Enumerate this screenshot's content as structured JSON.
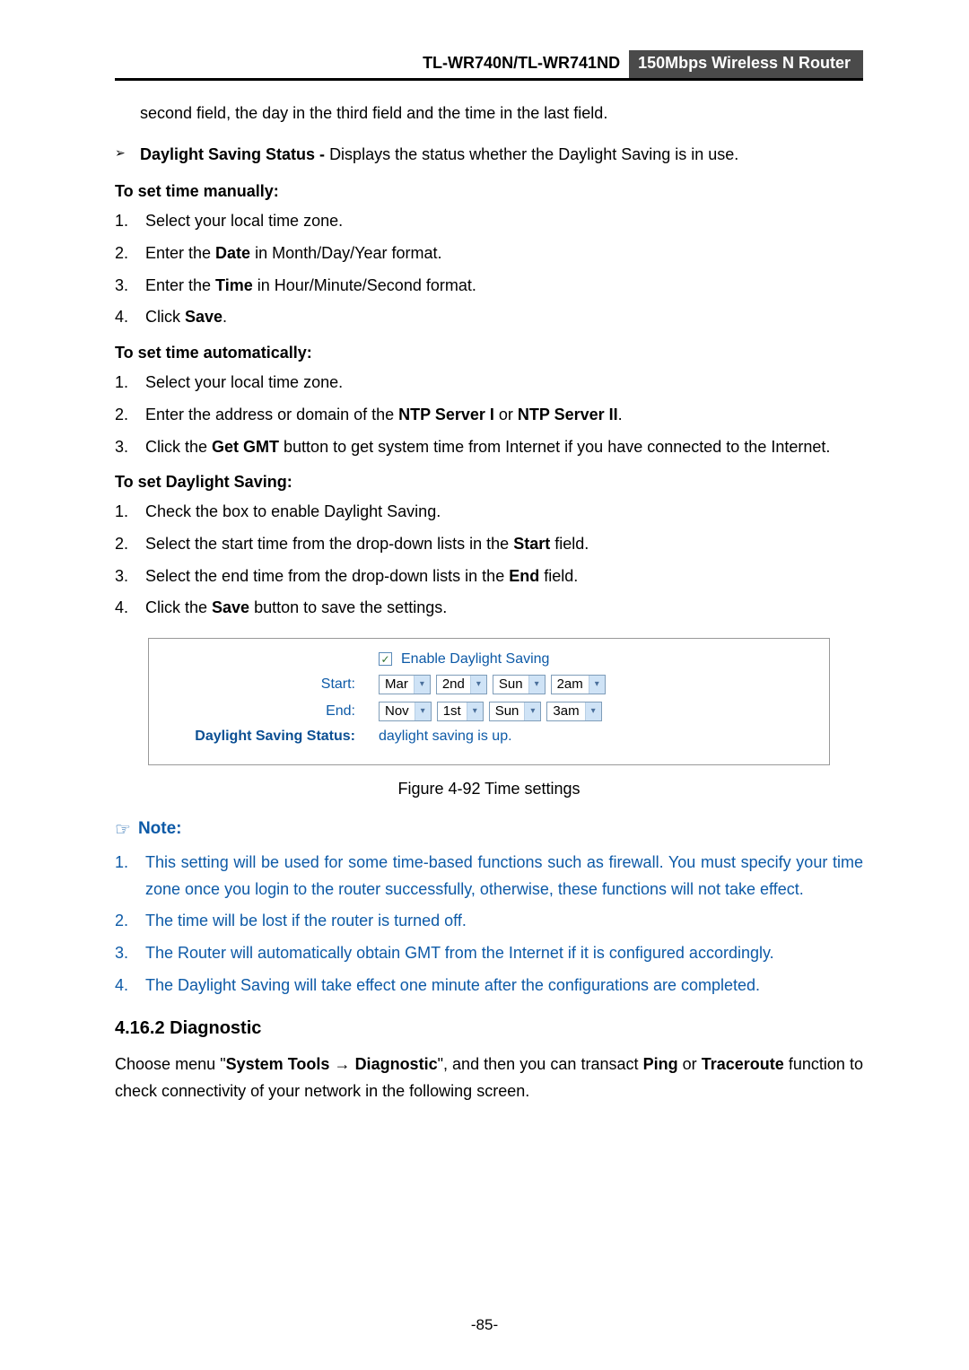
{
  "header": {
    "model": "TL-WR740N/TL-WR741ND",
    "product": "150Mbps Wireless N Router"
  },
  "intro_continuation": "second field, the day in the third field and the time in the last field.",
  "bullet": {
    "marker": "➢",
    "label": "Daylight Saving Status -",
    "desc": "Displays the status whether the Daylight Saving is in use."
  },
  "manual": {
    "heading": "To set time manually:",
    "steps": [
      {
        "n": "1.",
        "pre": "Select your local time zone."
      },
      {
        "n": "2.",
        "pre": "Enter the ",
        "b": "Date",
        "post": " in Month/Day/Year format."
      },
      {
        "n": "3.",
        "pre": "Enter the ",
        "b": "Time",
        "post": " in Hour/Minute/Second format."
      },
      {
        "n": "4.",
        "pre": "Click ",
        "b": "Save",
        "post": "."
      }
    ]
  },
  "auto": {
    "heading": "To set time automatically:",
    "steps": [
      {
        "n": "1.",
        "txt": "Select your local time zone."
      },
      {
        "n": "2.",
        "pre": "Enter the address or domain of the ",
        "b1": "NTP Server I",
        "mid": " or ",
        "b2": "NTP Server II",
        "post": "."
      },
      {
        "n": "3.",
        "pre": "Click the ",
        "b": "Get GMT",
        "post": " button to get system time from Internet if you have connected to the Internet."
      }
    ]
  },
  "dst": {
    "heading": "To set Daylight Saving:",
    "steps": [
      {
        "n": "1.",
        "txt": "Check the box to enable Daylight Saving."
      },
      {
        "n": "2.",
        "pre": "Select the start time from the drop-down lists in the ",
        "b": "Start",
        "post": " field."
      },
      {
        "n": "3.",
        "pre": "Select the end time from the drop-down lists in the ",
        "b": "End",
        "post": " field."
      },
      {
        "n": "4.",
        "pre": "Click the ",
        "b": "Save",
        "post": " button to save the settings."
      }
    ]
  },
  "panel": {
    "enable_label": "Enable Daylight Saving",
    "rows": [
      {
        "label": "Start:",
        "vals": [
          "Mar",
          "2nd",
          "Sun",
          "2am"
        ]
      },
      {
        "label": "End:",
        "vals": [
          "Nov",
          "1st",
          "Sun",
          "3am"
        ]
      }
    ],
    "status_label": "Daylight Saving Status:",
    "status_value": "daylight saving is up."
  },
  "figure_caption": "Figure 4-92   Time settings",
  "note": {
    "icon": "☞",
    "label": "Note:",
    "items": [
      {
        "n": "1.",
        "txt": "This setting will be used for some time-based functions such as firewall. You must specify your time zone once you login to the router successfully, otherwise, these functions will not take effect."
      },
      {
        "n": "2.",
        "txt": "The time will be lost if the router is turned off."
      },
      {
        "n": "3.",
        "txt": "The Router will automatically obtain GMT from the Internet if it is configured accordingly."
      },
      {
        "n": "4.",
        "txt": "The Daylight Saving will take effect one minute after the configurations are completed."
      }
    ]
  },
  "section": {
    "number_title": "4.16.2  Diagnostic",
    "p_pre": "Choose menu \"",
    "p_b1": "System Tools",
    "p_arrow": " → ",
    "p_b2": "Diagnostic",
    "p_mid": "\", and then you can transact ",
    "p_b3": "Ping",
    "p_or": " or ",
    "p_b4": "Traceroute",
    "p_post": " function to check connectivity of your network in the following screen."
  },
  "page_number": "-85-"
}
